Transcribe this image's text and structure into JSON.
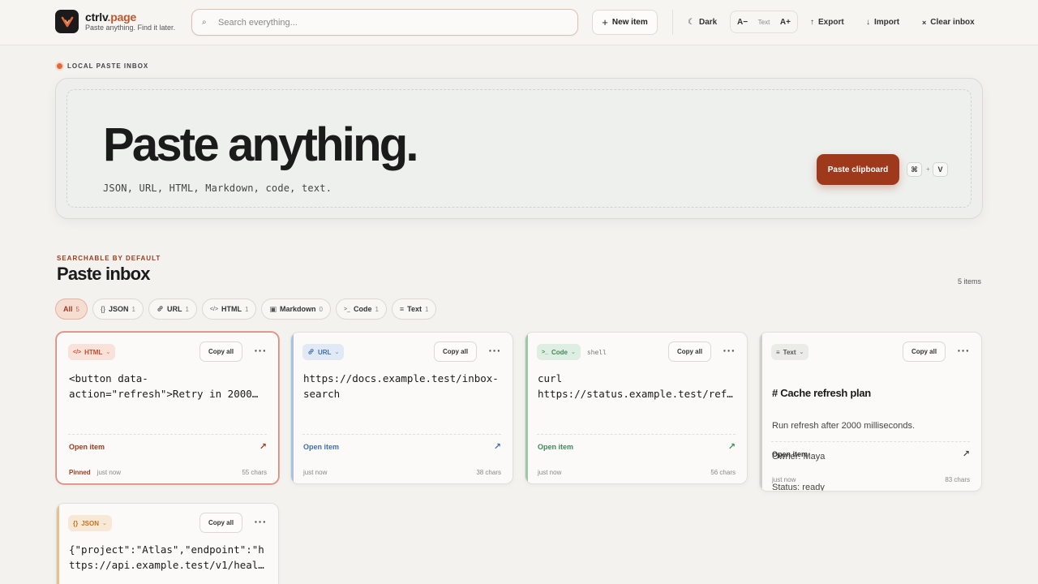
{
  "app": {
    "name_main": "ctrlv",
    "name_tld": ".page",
    "tagline": "Paste anything. Find it later."
  },
  "toolbar": {
    "search_placeholder": "Search everything...",
    "new_item": "New item",
    "dark": "Dark",
    "text_smaller": "A−",
    "text_label": "Text",
    "text_larger": "A+",
    "export": "Export",
    "import": "Import",
    "clear": "Clear inbox"
  },
  "hero": {
    "eyebrow": "LOCAL PASTE INBOX",
    "title": "Paste anything.",
    "subtitle": "JSON, URL, HTML, Markdown, code, text.",
    "paste_button": "Paste clipboard",
    "kbd_mod": "⌘",
    "kbd_plus": "+",
    "kbd_key": "V"
  },
  "inbox": {
    "eyebrow": "SEARCHABLE BY DEFAULT",
    "title": "Paste inbox",
    "count": "5 items",
    "filters": [
      {
        "label": "All",
        "count": "5",
        "icon": ""
      },
      {
        "label": "JSON",
        "count": "1",
        "icon": "{}"
      },
      {
        "label": "URL",
        "count": "1",
        "icon": "🔗"
      },
      {
        "label": "HTML",
        "count": "1",
        "icon": "</>"
      },
      {
        "label": "Markdown",
        "count": "0",
        "icon": "▣"
      },
      {
        "label": "Code",
        "count": "1",
        "icon": ">_"
      },
      {
        "label": "Text",
        "count": "1",
        "icon": "≡"
      }
    ]
  },
  "cards": [
    {
      "type": "HTML",
      "content": "<button data-\naction=\"refresh\">Retry in 2000…",
      "copy": "Copy all",
      "open": "Open item",
      "pinned": "Pinned",
      "time": "just now",
      "chars": "55 chars",
      "accent": "#d27a62"
    },
    {
      "type": "URL",
      "content": "https://docs.example.test/inbox-\nsearch",
      "copy": "Copy all",
      "open": "Open item",
      "time": "just now",
      "chars": "38 chars",
      "accent": "#5b86c4"
    },
    {
      "type": "Code",
      "lang": "shell",
      "content": "curl\nhttps://status.example.test/ref…",
      "copy": "Copy all",
      "open": "Open item",
      "time": "just now",
      "chars": "56 chars",
      "accent": "#5a9a72"
    },
    {
      "type": "Text",
      "heading": "# Cache refresh plan",
      "line1": "Run refresh after 2000 milliseconds.",
      "line2": "Owner: Maya",
      "line3": "Status: ready",
      "copy": "Copy all",
      "open": "Open item",
      "time": "just now",
      "chars": "83 chars",
      "accent": "#9a9a98"
    },
    {
      "type": "JSON",
      "content": "{\"project\":\"Atlas\",\"endpoint\":\"h\nttps://api.example.test/v1/heal…",
      "copy": "Copy all",
      "accent": "#d9984e"
    }
  ],
  "colors": {
    "brand": "#9e3a1b",
    "html": "#c9492c",
    "url": "#3f6fb0",
    "code": "#3f8a5a",
    "json": "#c4731f"
  }
}
